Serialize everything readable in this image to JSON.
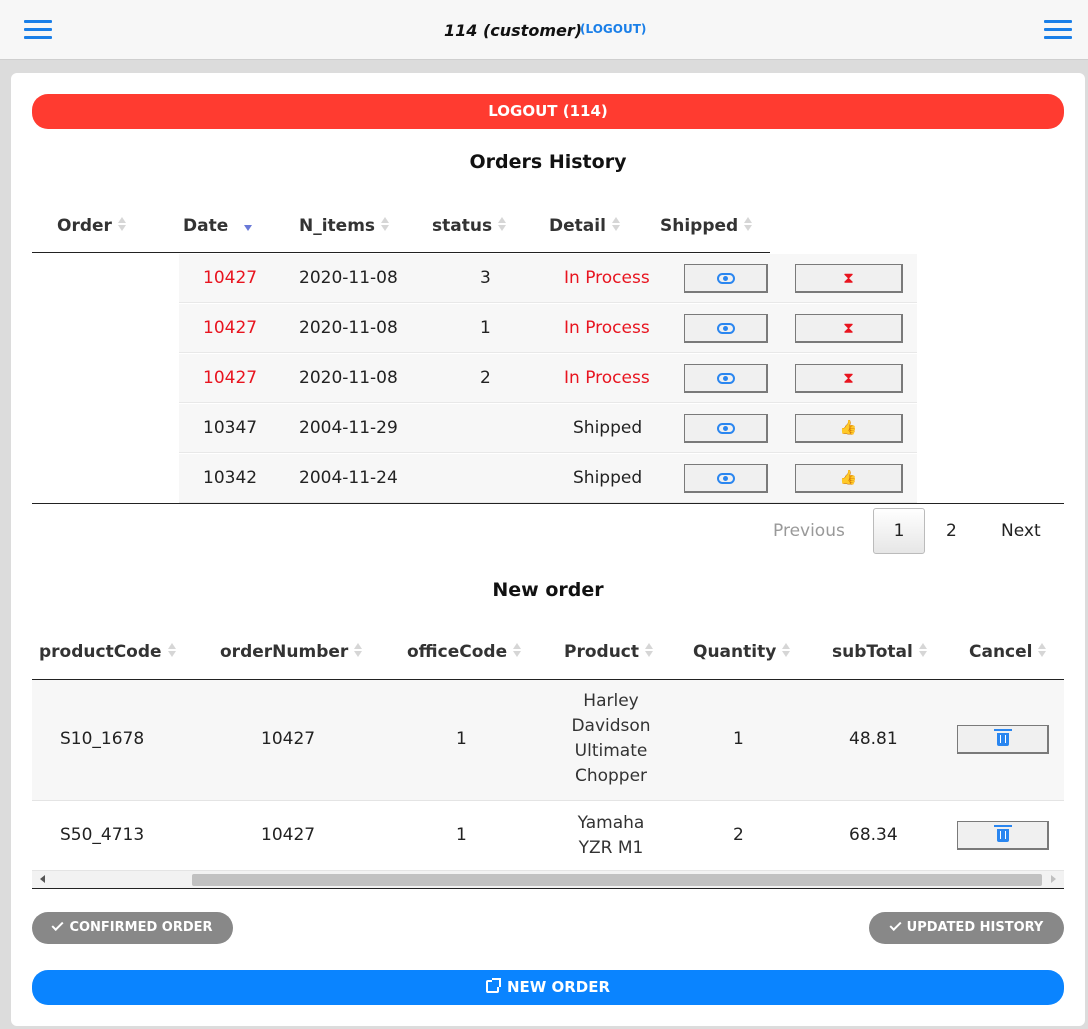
{
  "header": {
    "user_title": "114 (customer)",
    "logout_link": "(LOGOUT)"
  },
  "logout_button": "LOGOUT (114)",
  "history": {
    "title": "Orders History",
    "columns": [
      "Order",
      "Date",
      "N_items",
      "status",
      "Detail",
      "Shipped"
    ],
    "rows": [
      {
        "order": "10427",
        "date": "2020-11-08",
        "n_items": "3",
        "status": "In Process",
        "in_process": true
      },
      {
        "order": "10427",
        "date": "2020-11-08",
        "n_items": "1",
        "status": "In Process",
        "in_process": true
      },
      {
        "order": "10427",
        "date": "2020-11-08",
        "n_items": "2",
        "status": "In Process",
        "in_process": true
      },
      {
        "order": "10347",
        "date": "2004-11-29",
        "n_items": "",
        "status": "Shipped",
        "in_process": false
      },
      {
        "order": "10342",
        "date": "2004-11-24",
        "n_items": "",
        "status": "Shipped",
        "in_process": false
      }
    ],
    "pagination": {
      "previous": "Previous",
      "pages": [
        "1",
        "2"
      ],
      "current": "1",
      "next": "Next"
    }
  },
  "new_order": {
    "title": "New order",
    "columns": [
      "productCode",
      "orderNumber",
      "officeCode",
      "Product",
      "Quantity",
      "subTotal",
      "Cancel"
    ],
    "rows": [
      {
        "product_code": "S10_1678",
        "order_number": "10427",
        "office_code": "1",
        "product_lines": [
          "Harley",
          "Davidson",
          "Ultimate",
          "Chopper"
        ],
        "quantity": "1",
        "subtotal": "48.81"
      },
      {
        "product_code": "S50_4713",
        "order_number": "10427",
        "office_code": "1",
        "product_lines": [
          "Yamaha",
          "YZR M1"
        ],
        "quantity": "2",
        "subtotal": "68.34"
      }
    ]
  },
  "buttons": {
    "confirmed_order": "CONFIRMED ORDER",
    "updated_history": "UPDATED HISTORY",
    "new_order": "NEW ORDER"
  },
  "icons": {
    "detail": "eye-icon",
    "shipped_pending": "hourglass-icon",
    "shipped_done": "thumbs-up-icon",
    "cancel": "trash-icon",
    "menu": "hamburger-menu-icon"
  },
  "colors": {
    "accent": "#1a7fe8",
    "logout": "#ff3b30",
    "in_process": "#e8141f",
    "new_order": "#0a84ff",
    "status_pill": "#888888"
  }
}
